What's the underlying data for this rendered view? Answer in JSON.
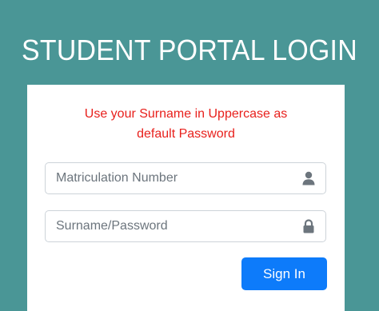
{
  "page": {
    "title": "STUDENT PORTAL LOGIN"
  },
  "notice": {
    "line1": "Use your Surname in Uppercase as",
    "line2": "default Password"
  },
  "form": {
    "matric_placeholder": "Matriculation Number",
    "matric_value": "",
    "matric_icon": "user-icon",
    "password_placeholder": "Surname/Password",
    "password_value": "",
    "password_icon": "lock-icon",
    "submit_label": "Sign In"
  },
  "colors": {
    "background": "#4a9696",
    "card": "#ffffff",
    "notice_text": "#e8201c",
    "primary_button": "#0d7bfa",
    "icon": "#6c757d"
  }
}
